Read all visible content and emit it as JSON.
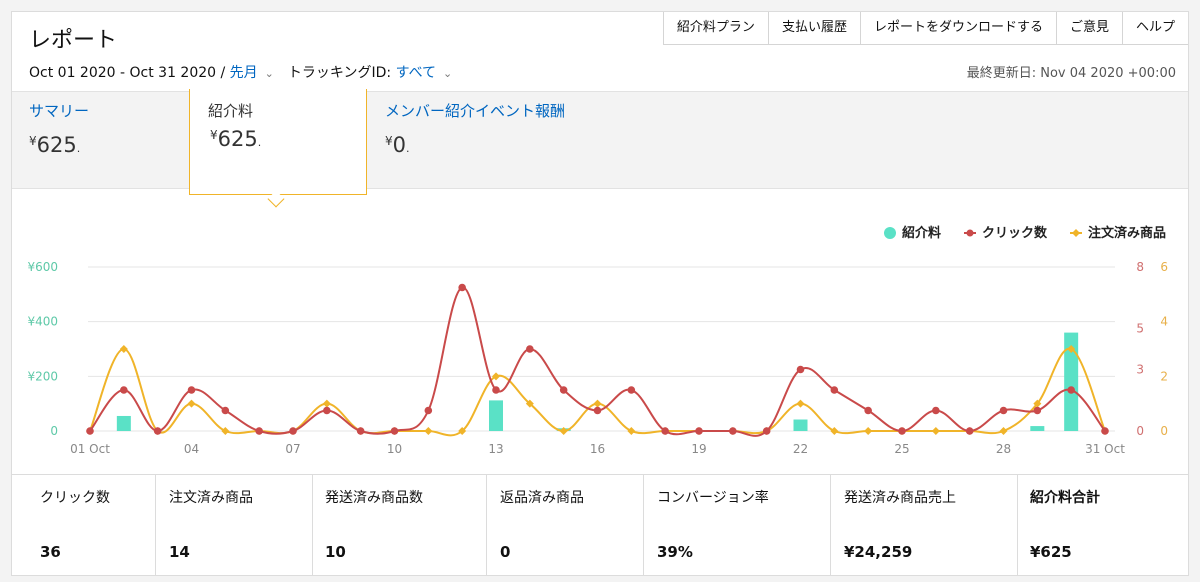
{
  "header": {
    "title": "レポート",
    "nav": [
      "紹介料プラン",
      "支払い履歴",
      "レポートをダウンロードする",
      "ご意見",
      "ヘルプ"
    ],
    "date_range": "Oct 01 2020 - Oct 31 2020 /",
    "period_link": "先月",
    "tracking_label": "トラッキングID:",
    "tracking_link": "すべて",
    "updated": "最終更新日: Nov 04 2020 +00:00"
  },
  "summary": {
    "tab1_label": "サマリー",
    "tab1_value": "625",
    "tab2_label": "紹介料",
    "tab2_value": "625",
    "tab3_label": "メンバー紹介イベント報酬",
    "tab3_value": "0",
    "currency": "¥",
    "dot": "."
  },
  "stats": [
    {
      "label": "クリック数",
      "value": "36"
    },
    {
      "label": "注文済み商品",
      "value": "14"
    },
    {
      "label": "発送済み商品数",
      "value": "10"
    },
    {
      "label": "返品済み商品",
      "value": "0"
    },
    {
      "label": "コンバージョン率",
      "value": "39%"
    },
    {
      "label": "発送済み商品売上",
      "value": "¥24,259"
    },
    {
      "label": "紹介料合計",
      "value": "¥625"
    }
  ],
  "chart_data": {
    "type": "line",
    "x": [
      1,
      2,
      3,
      4,
      5,
      6,
      7,
      8,
      9,
      10,
      11,
      12,
      13,
      14,
      15,
      16,
      17,
      18,
      19,
      20,
      21,
      22,
      23,
      24,
      25,
      26,
      27,
      28,
      29,
      30,
      31
    ],
    "x_tick_labels": {
      "1": "01 Oct",
      "4": "04",
      "7": "07",
      "10": "10",
      "13": "13",
      "16": "16",
      "19": "19",
      "22": "22",
      "25": "25",
      "28": "28",
      "31": "31 Oct"
    },
    "y_left_ticks": [
      "0",
      "¥200",
      "¥400",
      "¥600"
    ],
    "y_left_range": [
      0,
      600
    ],
    "y_click_ticks": [
      "0",
      "3",
      "5",
      "8"
    ],
    "y_click_range": [
      0,
      8
    ],
    "y_order_ticks": [
      "0",
      "2",
      "4",
      "6"
    ],
    "y_order_range": [
      0,
      6
    ],
    "legend": [
      "紹介料",
      "クリック数",
      "注文済み商品"
    ],
    "legend_position": "top-right",
    "colors": {
      "referral": "#5ae1c6",
      "clicks": "#c94a4a",
      "orders": "#f0b429",
      "grid": "#e5e5e5",
      "left_axis": "#5ec9a8",
      "mid_axis": "#d07070",
      "right_axis": "#e8b04a"
    },
    "series": [
      {
        "name": "紹介料",
        "kind": "bar",
        "values": [
          0,
          55,
          0,
          0,
          0,
          0,
          0,
          0,
          0,
          0,
          0,
          0,
          112,
          0,
          10,
          0,
          0,
          0,
          0,
          0,
          0,
          42,
          0,
          0,
          0,
          0,
          0,
          0,
          18,
          360,
          0
        ]
      },
      {
        "name": "クリック数",
        "kind": "line",
        "values": [
          0,
          2,
          0,
          2,
          1,
          0,
          0,
          1,
          0,
          0,
          1,
          7,
          2,
          4,
          2,
          1,
          2,
          0,
          0,
          0,
          0,
          3,
          2,
          1,
          0,
          1,
          0,
          1,
          1,
          2,
          0
        ]
      },
      {
        "name": "注文済み商品",
        "kind": "line",
        "values": [
          0,
          3,
          0,
          1,
          0,
          0,
          0,
          1,
          0,
          0,
          0,
          0,
          2,
          1,
          0,
          1,
          0,
          0,
          0,
          0,
          0,
          1,
          0,
          0,
          0,
          0,
          0,
          0,
          1,
          3,
          0
        ]
      }
    ]
  }
}
